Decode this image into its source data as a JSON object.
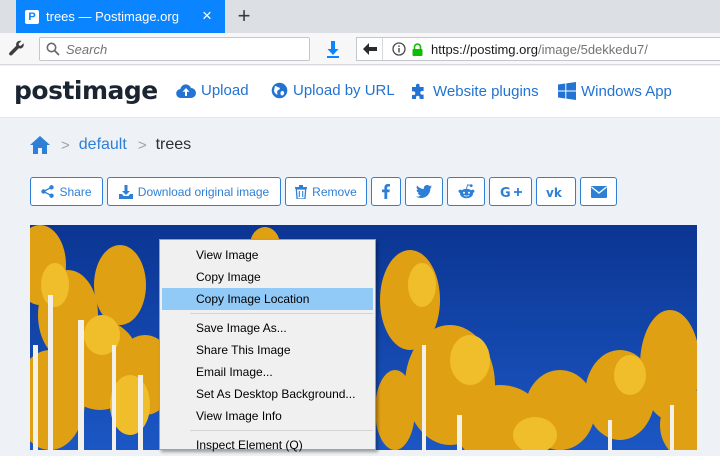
{
  "browser": {
    "tab_title": "trees — Postimage.org",
    "tab_favicon": "P",
    "close_icon": "close-icon",
    "new_tab": "+",
    "search_placeholder": "Search",
    "url_host": "https://postimg.org",
    "url_path": "/image/5dekkedu7/"
  },
  "site": {
    "logo": "postimage",
    "nav": [
      {
        "label": "Upload",
        "icon": "cloud-upload-icon"
      },
      {
        "label": "Upload by URL",
        "icon": "globe-icon"
      },
      {
        "label": "Website plugins",
        "icon": "puzzle-icon"
      },
      {
        "label": "Windows App",
        "icon": "windows-icon"
      }
    ]
  },
  "breadcrumb": {
    "home_icon": "home-icon",
    "album": "default",
    "current": "trees"
  },
  "actions": {
    "share": "Share",
    "download": "Download original image",
    "remove": "Remove",
    "social": [
      "facebook",
      "twitter",
      "reddit",
      "google-plus",
      "vk",
      "email"
    ]
  },
  "context_menu": {
    "items": [
      "View Image",
      "Copy Image",
      "Copy Image Location",
      "Save Image As...",
      "Share This Image",
      "Email Image...",
      "Set As Desktop Background...",
      "View Image Info",
      "Inspect Element (Q)"
    ],
    "highlighted": "Copy Image Location"
  },
  "colors": {
    "accent": "#2e7fd6",
    "tab_active": "#0a84ff",
    "menu_highlight": "#91c9f7",
    "sky": "#0e3d9c",
    "foliage": "#e6a91a"
  }
}
